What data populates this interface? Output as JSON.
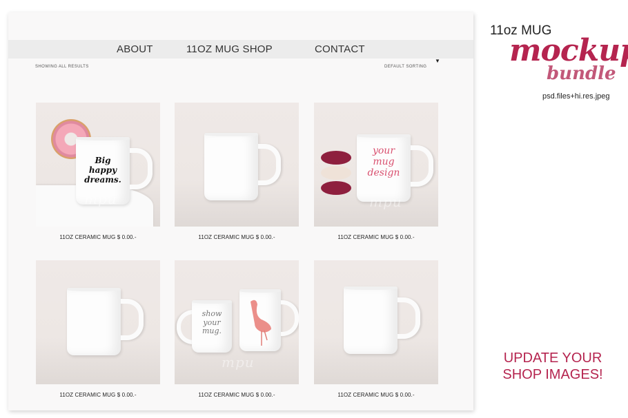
{
  "nav": {
    "items": [
      {
        "label": "ABOUT"
      },
      {
        "label": "11OZ MUG SHOP"
      },
      {
        "label": "CONTACT"
      }
    ]
  },
  "toolbar": {
    "results_text": "SHOWING ALL RESULTS",
    "sorting_label": "DEFAULT SORTING"
  },
  "products": [
    {
      "name": "11OZ CERAMIC MUG",
      "price": "$ 0.00.-",
      "mug_text": "Big happy dreams."
    },
    {
      "name": "11OZ CERAMIC MUG",
      "price": "$ 0.00.-"
    },
    {
      "name": "11OZ CERAMIC MUG",
      "price": "$ 0.00.-",
      "mug_text": "your mug design"
    },
    {
      "name": "11OZ CERAMIC MUG",
      "price": "$ 0.00.-"
    },
    {
      "name": "11OZ CERAMIC MUG",
      "price": "$ 0.00.-",
      "mug_text": "show your mug."
    },
    {
      "name": "11OZ CERAMIC MUG",
      "price": "$ 0.00.-"
    }
  ],
  "watermark": "mpu",
  "promo": {
    "title": "11oz MUG",
    "brand_line1": "mockup",
    "brand_line2": "bundle",
    "files_note": "psd.files+hi.res.jpeg",
    "cta_line1": "UPDATE YOUR",
    "cta_line2": "SHOP IMAGES!"
  },
  "colors": {
    "accent": "#b5244f",
    "nav_bar": "#ececec",
    "frame": "#f9f8f8"
  }
}
